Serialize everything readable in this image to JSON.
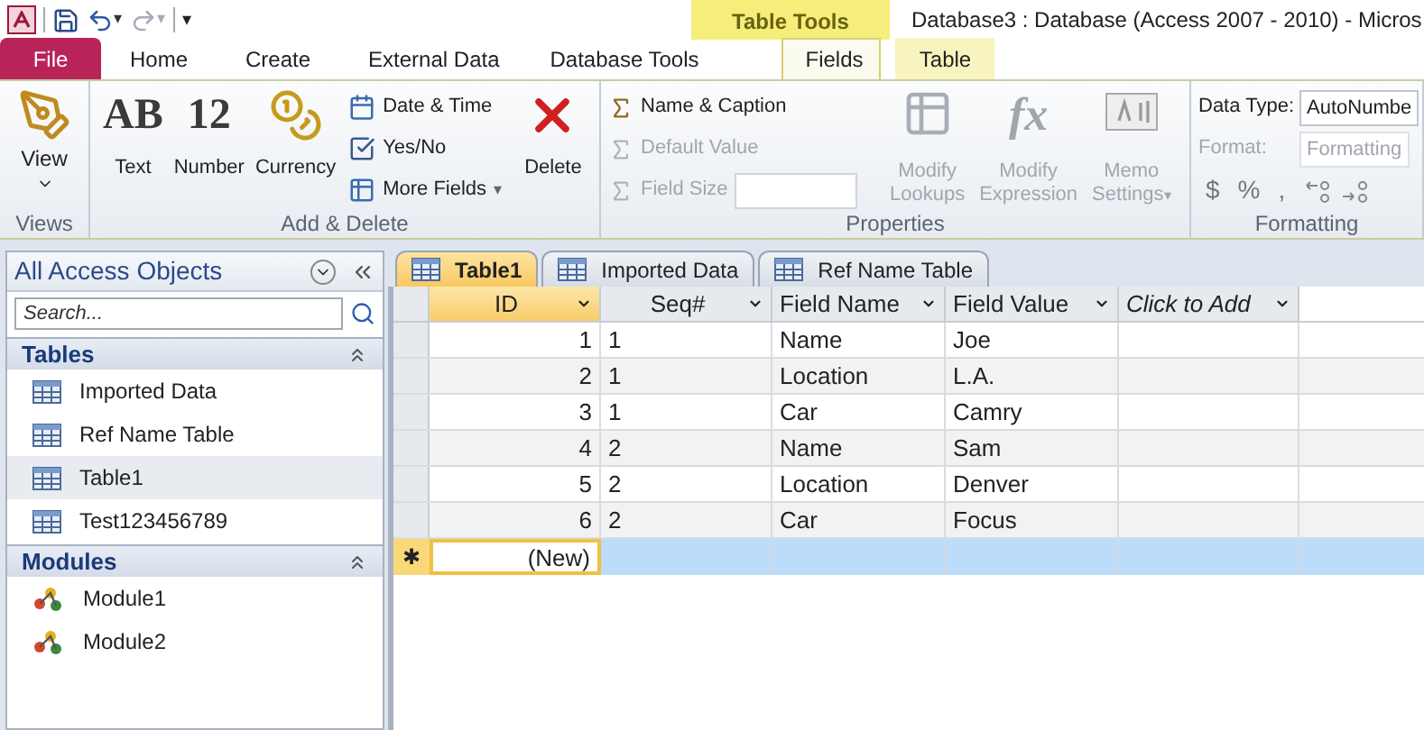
{
  "quick_access": {
    "undo_caret": "▾",
    "redo_caret": "▾",
    "customize": "▾"
  },
  "context_tab": {
    "label": "Table Tools"
  },
  "window": {
    "title": "Database3 : Database (Access 2007 - 2010)  -  Micros"
  },
  "ribbon_tabs": [
    {
      "label": "File",
      "kind": "file",
      "selected": false
    },
    {
      "label": "Home",
      "kind": "tab",
      "selected": false
    },
    {
      "label": "Create",
      "kind": "tab",
      "selected": false
    },
    {
      "label": "External Data",
      "kind": "tab",
      "selected": false
    },
    {
      "label": "Database Tools",
      "kind": "tab",
      "selected": false
    },
    {
      "label": "Fields",
      "kind": "context",
      "selected": true
    },
    {
      "label": "Table",
      "kind": "context",
      "selected": false
    }
  ],
  "ribbon": {
    "views": {
      "label": "Views",
      "view_button": "View"
    },
    "add_delete": {
      "label": "Add & Delete",
      "large": [
        {
          "label": "Text",
          "glyph": "AB",
          "kind": "glyph"
        },
        {
          "label": "Number",
          "glyph": "12",
          "kind": "glyph"
        },
        {
          "label": "Currency",
          "kind": "currency"
        }
      ],
      "small": [
        {
          "label": "Date & Time",
          "kind": "date"
        },
        {
          "label": "Yes/No",
          "kind": "check"
        },
        {
          "label": "More Fields",
          "kind": "more",
          "caret": "▾"
        }
      ],
      "delete": "Delete"
    },
    "properties": {
      "label": "Properties",
      "small": [
        {
          "label": "Name & Caption",
          "disabled": false
        },
        {
          "label": "Default Value",
          "disabled": true
        },
        {
          "label": "Field Size",
          "disabled": true
        }
      ],
      "large": [
        {
          "label": "Modify Lookups",
          "disabled": true,
          "kind": "lookups"
        },
        {
          "label": "Modify Expression",
          "disabled": true,
          "kind": "fx",
          "glyph": "fx"
        },
        {
          "label": "Memo Settings",
          "disabled": true,
          "kind": "memo",
          "caret": "▾"
        }
      ]
    },
    "formatting": {
      "label": "Formatting",
      "data_type_label": "Data Type:",
      "data_type_value": "AutoNumbe",
      "format_label": "Format:",
      "format_value": "Formatting",
      "format_disabled": true,
      "symbols": [
        "$",
        "%",
        ","
      ]
    }
  },
  "nav_pane": {
    "title": "All Access Objects",
    "search": {
      "placeholder": "Search..."
    },
    "groups": [
      {
        "label": "Tables",
        "kind": "table",
        "items": [
          {
            "label": "Imported Data",
            "selected": false
          },
          {
            "label": "Ref Name Table",
            "selected": false
          },
          {
            "label": "Table1",
            "selected": true
          },
          {
            "label": "Test123456789",
            "selected": false
          }
        ]
      },
      {
        "label": "Modules",
        "kind": "module",
        "items": [
          {
            "label": "Module1",
            "selected": false
          },
          {
            "label": "Module2",
            "selected": false
          }
        ]
      }
    ]
  },
  "document_tabs": [
    {
      "label": "Table1",
      "selected": true
    },
    {
      "label": "Imported Data",
      "selected": false
    },
    {
      "label": "Ref Name Table",
      "selected": false
    }
  ],
  "table": {
    "columns": [
      {
        "label": "ID",
        "selected": true,
        "kind": "field"
      },
      {
        "label": "Seq#",
        "selected": false,
        "kind": "field"
      },
      {
        "label": "Field Name",
        "selected": false,
        "kind": "field"
      },
      {
        "label": "Field Value",
        "selected": false,
        "kind": "field"
      },
      {
        "label": "Click to Add",
        "selected": false,
        "kind": "add"
      }
    ],
    "rows": [
      [
        "1",
        "1",
        "Name",
        "Joe",
        ""
      ],
      [
        "2",
        "1",
        "Location",
        "L.A.",
        ""
      ],
      [
        "3",
        "1",
        "Car",
        "Camry",
        ""
      ],
      [
        "4",
        "2",
        "Name",
        "Sam",
        ""
      ],
      [
        "5",
        "2",
        "Location",
        "Denver",
        ""
      ],
      [
        "6",
        "2",
        "Car",
        "Focus",
        ""
      ]
    ],
    "new_row": {
      "marker": "✱",
      "id": "(New)",
      "selected": true
    }
  }
}
